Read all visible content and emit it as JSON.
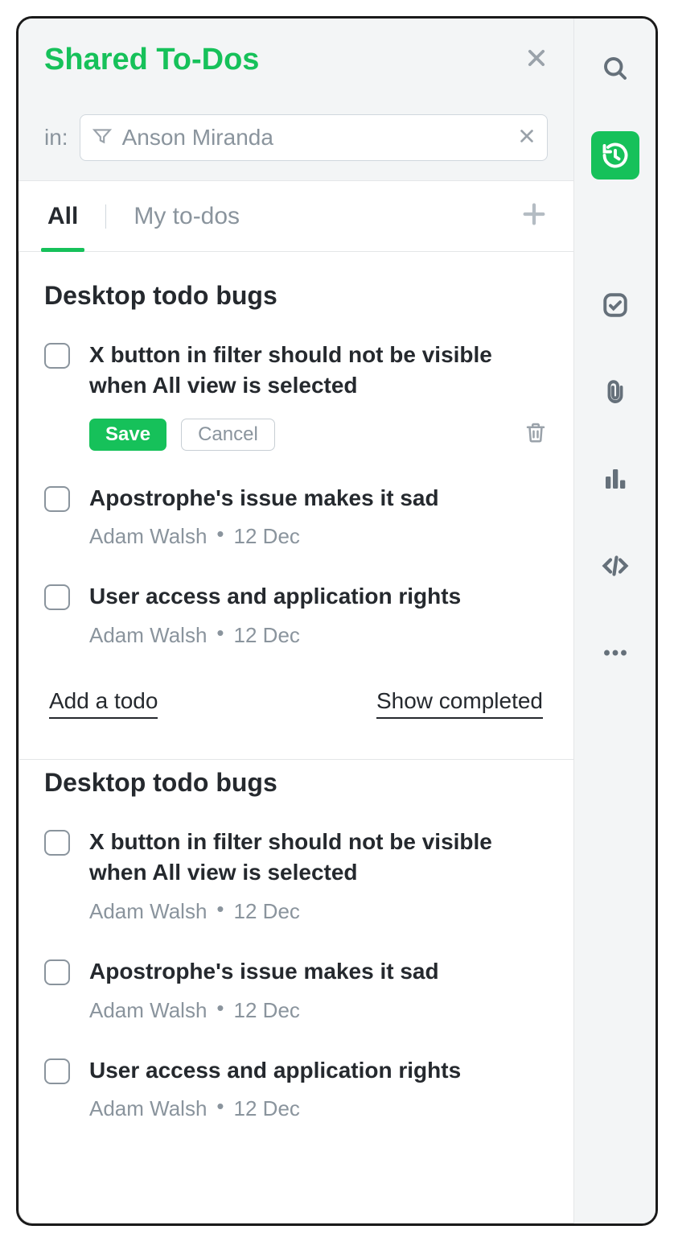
{
  "header": {
    "title": "Shared To-Dos",
    "filter_label": "in:",
    "filter_placeholder": "Anson Miranda"
  },
  "tabs": {
    "all": "All",
    "mine": "My to-dos"
  },
  "buttons": {
    "save": "Save",
    "cancel": "Cancel"
  },
  "footer_links": {
    "add": "Add a todo",
    "show_completed": "Show completed"
  },
  "sections": [
    {
      "title": "Desktop todo bugs",
      "show_footer": true,
      "items": [
        {
          "title": "X button in filter should not be visible when All view is selected",
          "editing": true
        },
        {
          "title": "Apostrophe's issue makes it sad",
          "author": "Adam Walsh",
          "date": "12 Dec"
        },
        {
          "title": "User access and application rights",
          "author": "Adam Walsh",
          "date": "12 Dec"
        }
      ]
    },
    {
      "title": "Desktop todo bugs",
      "show_footer": false,
      "items": [
        {
          "title": "X button in filter should not be visible when All view is selected",
          "author": "Adam Walsh",
          "date": "12 Dec"
        },
        {
          "title": "Apostrophe's issue makes it sad",
          "author": "Adam Walsh",
          "date": "12 Dec"
        },
        {
          "title": "User access and application rights",
          "author": "Adam Walsh",
          "date": "12 Dec"
        }
      ]
    }
  ]
}
